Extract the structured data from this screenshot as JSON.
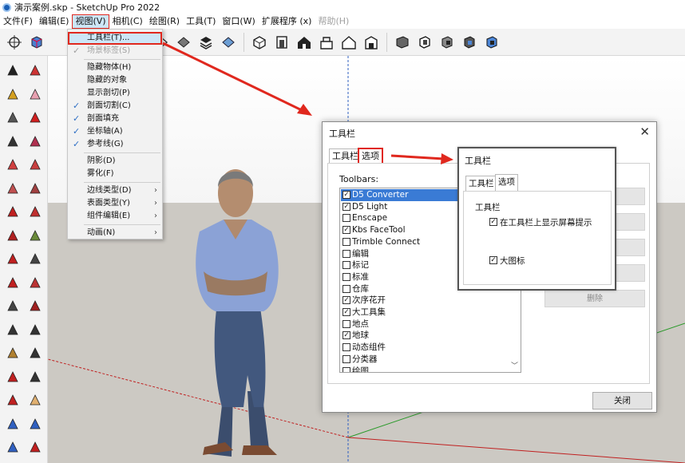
{
  "window": {
    "title": "演示案例.skp - SketchUp Pro 2022"
  },
  "menubar": [
    {
      "id": "file",
      "label": "文件(F)"
    },
    {
      "id": "edit",
      "label": "编辑(E)"
    },
    {
      "id": "view",
      "label": "视图(V)"
    },
    {
      "id": "camera",
      "label": "相机(C)"
    },
    {
      "id": "draw",
      "label": "绘图(R)"
    },
    {
      "id": "tools",
      "label": "工具(T)"
    },
    {
      "id": "window",
      "label": "窗口(W)"
    },
    {
      "id": "extensions",
      "label": "扩展程序 (x)"
    },
    {
      "id": "help",
      "label": "帮助(H)"
    }
  ],
  "view_menu": [
    {
      "label": "工具栏(T)...",
      "checked": false
    },
    {
      "label": "场景标签(S)",
      "checked": true
    },
    {
      "label": "隐藏物体(H)",
      "checked": false
    },
    {
      "label": "隐藏的对象",
      "checked": false
    },
    {
      "label": "显示剖切(P)",
      "checked": false
    },
    {
      "label": "剖面切割(C)",
      "checked": true
    },
    {
      "label": "剖面填充",
      "checked": true
    },
    {
      "label": "坐标轴(A)",
      "checked": true
    },
    {
      "label": "参考线(G)",
      "checked": true
    },
    {
      "label": "阴影(D)",
      "checked": false
    },
    {
      "label": "雾化(F)",
      "checked": false
    },
    {
      "label": "边线类型(D)",
      "checked": false
    },
    {
      "label": "表面类型(Y)",
      "checked": false
    },
    {
      "label": "组件编辑(E)",
      "checked": false
    },
    {
      "label": "动画(N)",
      "checked": false
    }
  ],
  "dialog": {
    "title": "工具栏",
    "close_glyph": "✕",
    "tab_toolbars": "工具栏",
    "tab_options": "选项",
    "list_label": "Toolbars:",
    "check_glyph": "✓",
    "toolbars": [
      {
        "label": "D5 Converter",
        "checked": true
      },
      {
        "label": "D5 Light",
        "checked": true
      },
      {
        "label": "Enscape",
        "checked": false
      },
      {
        "label": "Kbs FaceTool",
        "checked": true
      },
      {
        "label": "Trimble Connect",
        "checked": false
      },
      {
        "label": "编辑",
        "checked": false
      },
      {
        "label": "标记",
        "checked": false
      },
      {
        "label": "标准",
        "checked": false
      },
      {
        "label": "仓库",
        "checked": false
      },
      {
        "label": "次序花开",
        "checked": true
      },
      {
        "label": "大工具集",
        "checked": true
      },
      {
        "label": "地点",
        "checked": false
      },
      {
        "label": "地球",
        "checked": true
      },
      {
        "label": "动态组件",
        "checked": false
      },
      {
        "label": "分类器",
        "checked": false
      },
      {
        "label": "绘图",
        "checked": false
      }
    ],
    "delete_button": "删除",
    "close_button": "关闭"
  },
  "inset": {
    "title": "工具栏",
    "tab_toolbars": "工具栏",
    "tab_options": "选项",
    "group_label": "工具栏",
    "option_screentips": "在工具栏上显示屏幕提示",
    "option_large_icons": "大图标"
  },
  "colors": {
    "highlight_red": "#e0281e",
    "selection_blue": "#3a7bd5",
    "menu_hover": "#cde6f7"
  }
}
